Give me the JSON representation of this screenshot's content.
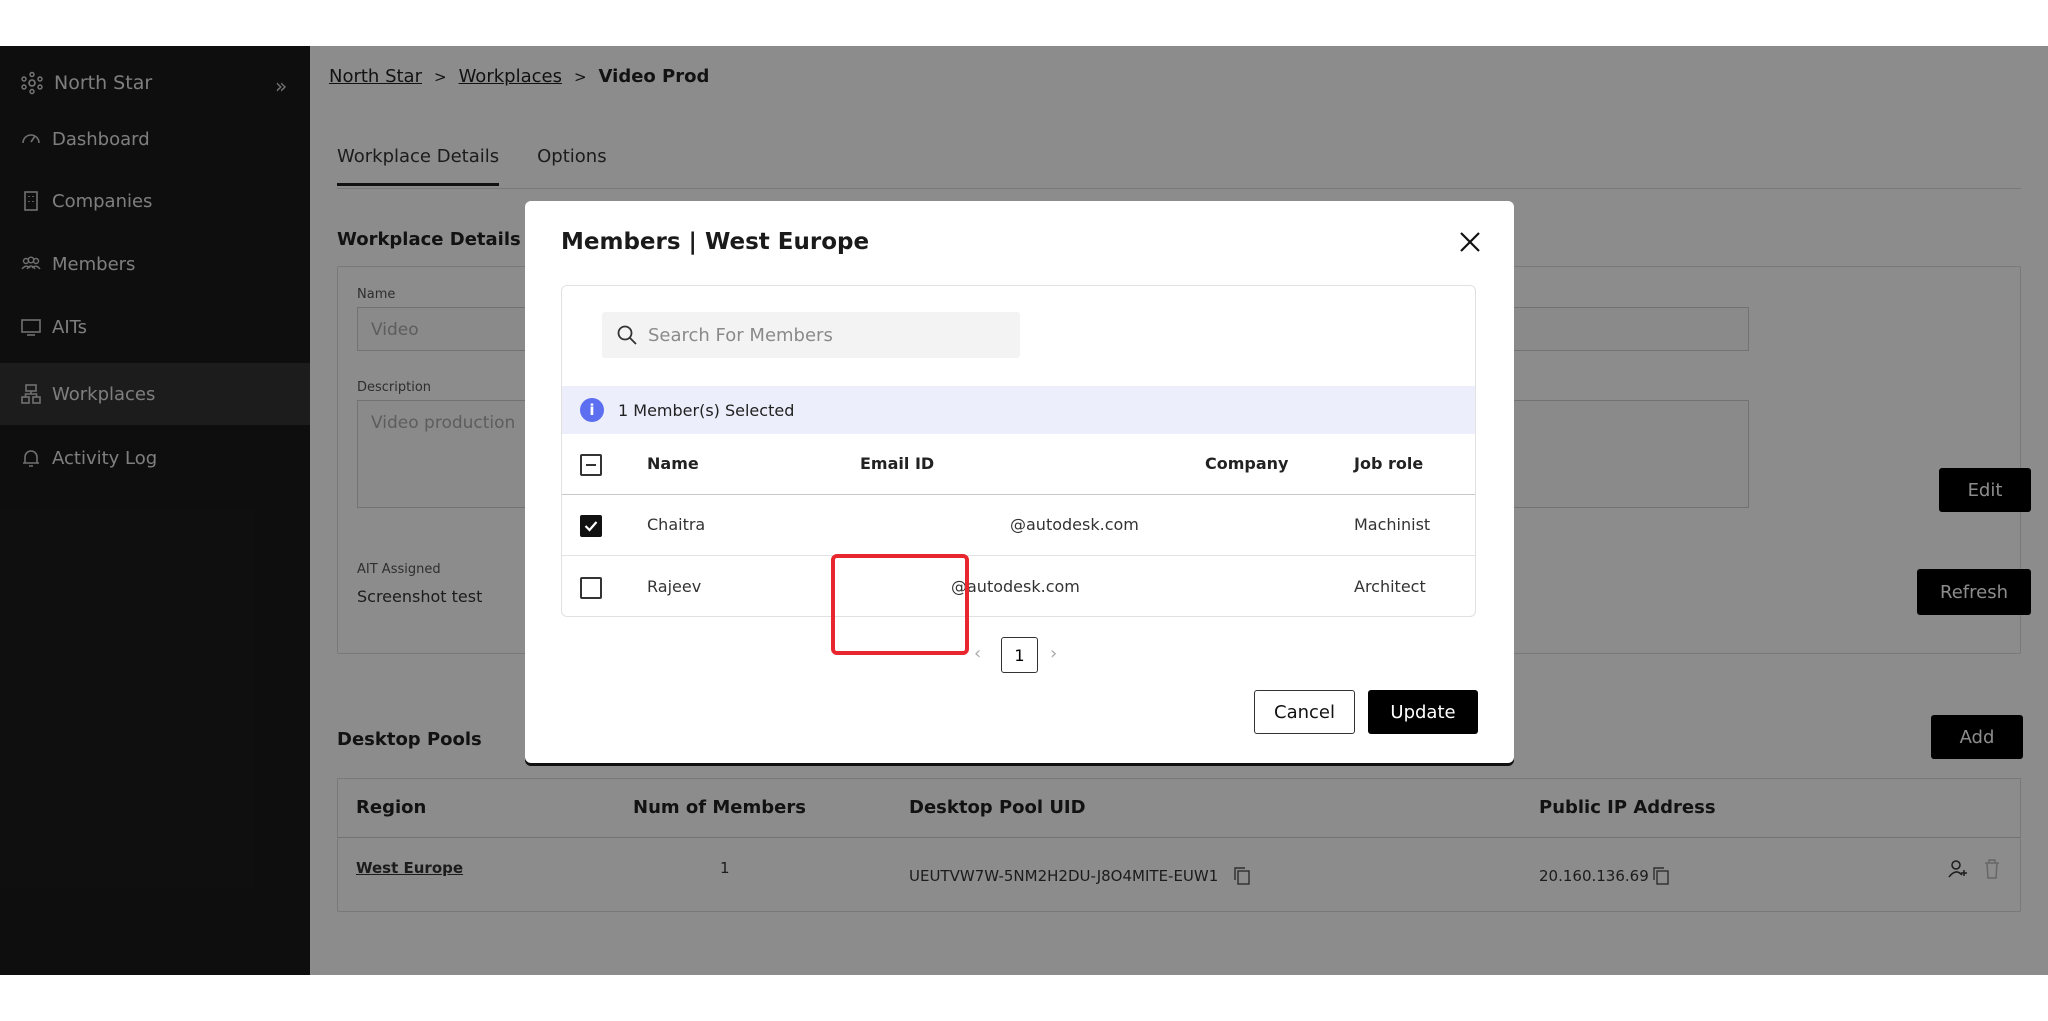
{
  "sidebar": {
    "brand": "North Star",
    "items": [
      {
        "label": "Dashboard",
        "icon": "dashboard-icon"
      },
      {
        "label": "Companies",
        "icon": "building-icon"
      },
      {
        "label": "Members",
        "icon": "people-icon"
      },
      {
        "label": "AITs",
        "icon": "monitor-icon"
      },
      {
        "label": "Workplaces",
        "icon": "workplace-icon"
      },
      {
        "label": "Activity Log",
        "icon": "bell-icon"
      }
    ]
  },
  "breadcrumb": {
    "root": "North Star",
    "section": "Workplaces",
    "current": "Video Prod"
  },
  "tabs": [
    "Workplace Details",
    "Options"
  ],
  "details": {
    "title": "Workplace Details",
    "name_label": "Name",
    "name_value": "Video",
    "description_label": "Description",
    "description_value": "Video production",
    "ait_label": "AIT Assigned",
    "ait_value": "Screenshot test",
    "edit_label": "Edit",
    "refresh_label": "Refresh"
  },
  "pools": {
    "title": "Desktop Pools",
    "add_label": "Add",
    "headers": [
      "Region",
      "Num of Members",
      "Desktop Pool UID",
      "Public IP Address"
    ],
    "rows": [
      {
        "region": "West Europe",
        "members": "1",
        "uid": "UEUTVW7W-5NM2H2DU-J8O4MITE-EUW1",
        "ip": "20.160.136.69"
      }
    ]
  },
  "modal": {
    "title": "Members | West Europe",
    "search_placeholder": "Search For Members",
    "selected_text": "1 Member(s) Selected",
    "headers": [
      "Name",
      "Email ID",
      "Company",
      "Job role"
    ],
    "rows": [
      {
        "name": "Chaitra",
        "email": "@autodesk.com",
        "company": "",
        "role": "Machinist",
        "checked": true
      },
      {
        "name": "Rajeev",
        "email": "@autodesk.com",
        "company": "",
        "role": "Architect",
        "checked": false
      }
    ],
    "page": "1",
    "cancel_label": "Cancel",
    "update_label": "Update"
  },
  "colors": {
    "highlight": "#e8262e",
    "info": "#5b6ff0",
    "sidebar": "#1b1b1b"
  }
}
